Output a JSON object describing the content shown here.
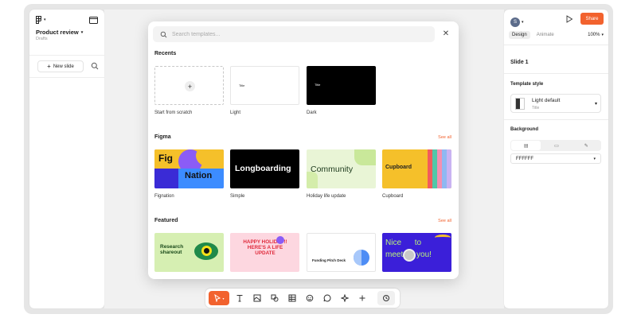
{
  "left_panel": {
    "file_name": "Product review",
    "file_sub": "Drafts",
    "new_slide_label": "New slide"
  },
  "right_panel": {
    "avatar_initial": "S",
    "share_label": "Share",
    "tabs": [
      "Design",
      "Animate"
    ],
    "zoom": "100%",
    "slide_title": "Slide 1",
    "template_style_label": "Template style",
    "template_style_name": "Light default",
    "template_style_sub": "Title",
    "background_label": "Background",
    "background_color": "FFFFFF"
  },
  "modal": {
    "search_placeholder": "Search templates...",
    "recents_label": "Recents",
    "recents": [
      {
        "caption": "Start from scratch"
      },
      {
        "caption": "Light",
        "mini_title": "Title"
      },
      {
        "caption": "Dark",
        "mini_title": "Title"
      }
    ],
    "figma_label": "Figma",
    "figma_see_all": "See all",
    "figma_templates": [
      {
        "caption": "Fignation",
        "line1": "Fig",
        "line2": "Nation"
      },
      {
        "caption": "Simple",
        "text": "Longboarding"
      },
      {
        "caption": "Holiday life update",
        "text": "Community"
      },
      {
        "caption": "Cupboard",
        "text": "Cupboard"
      }
    ],
    "featured_label": "Featured",
    "featured_see_all": "See all",
    "featured_templates": [
      {
        "text": "Research shareout"
      },
      {
        "text": "HAPPY HOLIDAY!! HERE'S A LIFE UPDATE"
      },
      {
        "text": "Funding Pitch Deck"
      },
      {
        "text": "Nice to meet you!"
      }
    ]
  },
  "colors": {
    "accent": "#f2622e",
    "figma_yellow": "#f5c02a",
    "figma_purple": "#8b5cf6",
    "community_green": "#dff0c3",
    "featured_purple": "#3b1fd9"
  },
  "toolbar": {
    "tools": [
      "move-tool",
      "text-tool",
      "image-tool",
      "shape-tool",
      "table-tool",
      "sticker-tool",
      "comment-tool",
      "ai-tool",
      "plus-tool",
      "more-tool"
    ]
  }
}
